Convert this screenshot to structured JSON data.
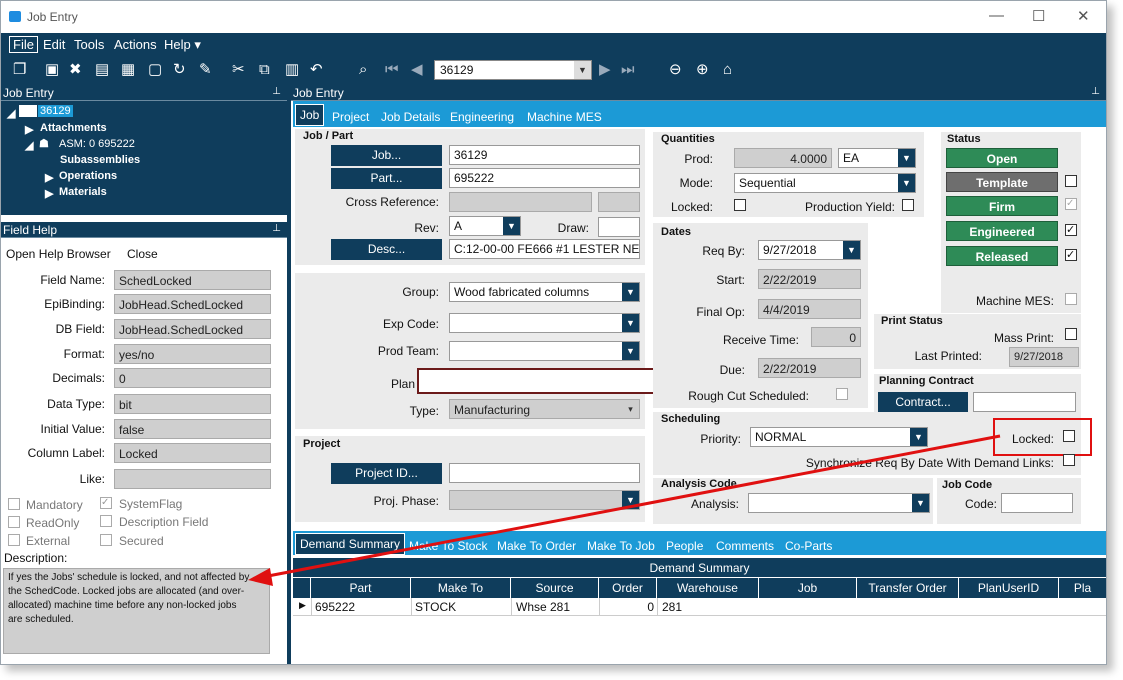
{
  "window": {
    "title": "Job Entry",
    "minimize": "—",
    "maximize": "☐",
    "close": "✕"
  },
  "menu": [
    "File",
    "Edit",
    "Tools",
    "Actions",
    "Help ▾"
  ],
  "toolbar": {
    "job_number": "36129"
  },
  "tree": {
    "header": "Job Entry",
    "root": "36129",
    "attachments": "Attachments",
    "asm": "ASM: 0 695222",
    "subassemblies": "Subassemblies",
    "operations": "Operations",
    "materials": "Materials"
  },
  "field_help": {
    "header": "Field Help",
    "open_browser": "Open Help Browser",
    "close": "Close",
    "rows": [
      {
        "label": "Field Name:",
        "value": "SchedLocked"
      },
      {
        "label": "EpiBinding:",
        "value": "JobHead.SchedLocked"
      },
      {
        "label": "DB Field:",
        "value": "JobHead.SchedLocked"
      },
      {
        "label": "Format:",
        "value": "yes/no"
      },
      {
        "label": "Decimals:",
        "value": "0"
      },
      {
        "label": "Data Type:",
        "value": "bit"
      },
      {
        "label": "Initial Value:",
        "value": "false"
      },
      {
        "label": "Column Label:",
        "value": "Locked"
      },
      {
        "label": "Like:",
        "value": ""
      }
    ],
    "checks": {
      "mandatory": "Mandatory",
      "readonly": "ReadOnly",
      "external": "External",
      "systemflag": "SystemFlag",
      "descfield": "Description Field",
      "secured": "Secured"
    },
    "description_label": "Description:",
    "description": "If yes the Jobs' schedule is locked, and not affected by the SchedCode.  Locked jobs are allocated (and over-allocated) machine time before any non-locked jobs are scheduled."
  },
  "main": {
    "header": "Job Entry",
    "tabs": {
      "selected": "Job",
      "others": [
        "Project",
        "Job Details",
        "Engineering",
        "Machine MES"
      ]
    },
    "job_part": {
      "title": "Job / Part",
      "job_btn": "Job...",
      "job": "36129",
      "part_btn": "Part...",
      "part": "695222",
      "cross_ref": "Cross Reference:",
      "rev_label": "Rev:",
      "rev": "A",
      "draw_label": "Draw:",
      "desc_btn": "Desc...",
      "desc": "C:12-00-00 FE666 #1 LESTER NE"
    },
    "group": {
      "group_label": "Group:",
      "group": "Wood fabricated columns",
      "exp_label": "Exp Code:",
      "prod_team_label": "Prod Team:",
      "plan_label": "Plan",
      "type_label": "Type:",
      "type": "Manufacturing"
    },
    "project": {
      "title": "Project",
      "project_btn": "Project ID...",
      "phase_label": "Proj. Phase:"
    },
    "quantities": {
      "title": "Quantities",
      "prod_label": "Prod:",
      "prod": "4.0000",
      "uom": "EA",
      "mode_label": "Mode:",
      "mode": "Sequential",
      "locked_label": "Locked:",
      "yield_label": "Production Yield:"
    },
    "dates": {
      "title": "Dates",
      "reqby_label": "Req By:",
      "reqby": "9/27/2018",
      "start_label": "Start:",
      "start": "2/22/2019",
      "finalop_label": "Final Op:",
      "finalop": "4/4/2019",
      "receive_label": "Receive Time:",
      "receive": "0",
      "due_label": "Due:",
      "due": "2/22/2019",
      "roughcut_label": "Rough Cut Scheduled:"
    },
    "status": {
      "title": "Status",
      "open": "Open",
      "template": "Template",
      "firm": "Firm",
      "engineered": "Engineered",
      "released": "Released",
      "mes_label": "Machine MES:"
    },
    "print": {
      "title": "Print Status",
      "mass_label": "Mass Print:",
      "last_label": "Last Printed:",
      "last": "9/27/2018"
    },
    "planning": {
      "title": "Planning Contract",
      "contract_btn": "Contract..."
    },
    "scheduling": {
      "title": "Scheduling",
      "priority_label": "Priority:",
      "priority": "NORMAL",
      "locked_label": "Locked:",
      "sync_label": "Synchronize Req By Date With Demand Links:"
    },
    "analysis": {
      "title": "Analysis Code",
      "analysis_label": "Analysis:"
    },
    "jobcode": {
      "title": "Job Code",
      "code_label": "Code:"
    },
    "bottom_tabs": {
      "selected": "Demand Summary",
      "others": [
        "Make To Stock",
        "Make To Order",
        "Make To Job",
        "People",
        "Comments",
        "Co-Parts"
      ]
    },
    "grid": {
      "title": "Demand Summary",
      "columns": [
        "Part",
        "Make To",
        "Source",
        "Order",
        "Warehouse",
        "Job",
        "Transfer Order",
        "PlanUserID",
        "Pla"
      ],
      "row": {
        "part": "695222",
        "make_to": "STOCK",
        "source": "Whse 281",
        "order": "0",
        "warehouse": "281"
      }
    }
  },
  "colors": {
    "navy": "#0f3d5c",
    "tab_blue": "#1c9ad6",
    "status_green": "#2e8b57",
    "annotation_red": "#e01010"
  }
}
